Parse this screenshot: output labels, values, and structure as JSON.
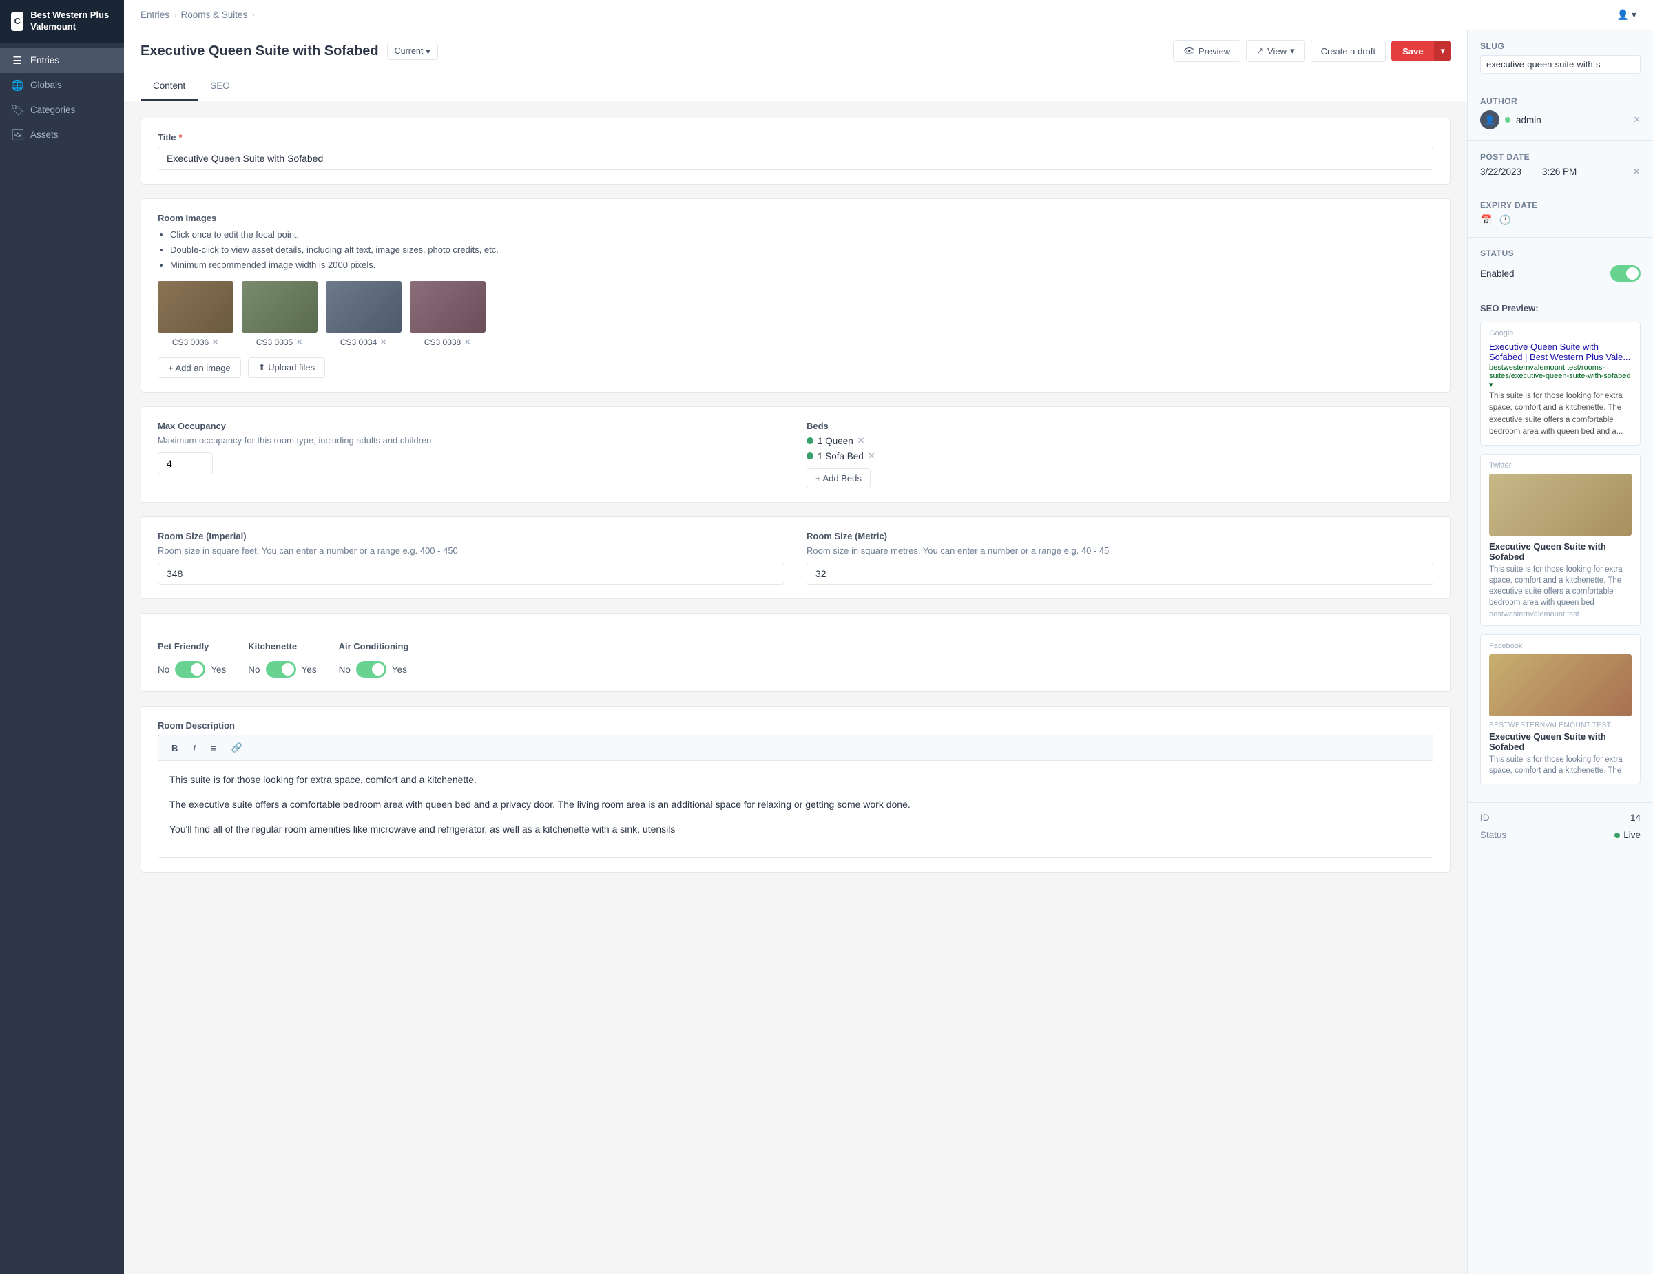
{
  "app": {
    "logo_text": "C",
    "brand_name": "Best Western Plus Valemount"
  },
  "sidebar": {
    "items": [
      {
        "id": "entries",
        "label": "Entries",
        "icon": "☰",
        "active": true
      },
      {
        "id": "globals",
        "label": "Globals",
        "icon": "🌐"
      },
      {
        "id": "categories",
        "label": "Categories",
        "icon": "🏷"
      },
      {
        "id": "assets",
        "label": "Assets",
        "icon": "🖼"
      }
    ]
  },
  "breadcrumb": {
    "items": [
      "Entries",
      "Rooms & Suites"
    ]
  },
  "entry_header": {
    "title": "Executive Queen Suite with Sofabed",
    "current_badge": "Current",
    "preview_label": "Preview",
    "view_label": "View",
    "draft_label": "Create a draft",
    "save_label": "Save"
  },
  "tabs": [
    {
      "id": "content",
      "label": "Content",
      "active": true
    },
    {
      "id": "seo",
      "label": "SEO",
      "active": false
    }
  ],
  "form": {
    "title_label": "Title",
    "title_value": "Executive Queen Suite with Sofabed",
    "room_images_label": "Room Images",
    "room_images_instructions": [
      "Click once to edit the focal point.",
      "Double-click to view asset details, including alt text, image sizes, photo credits, etc.",
      "Minimum recommended image width is 2000 pixels."
    ],
    "images": [
      {
        "label": "CS3 0036"
      },
      {
        "label": "CS3 0035"
      },
      {
        "label": "CS3 0034"
      },
      {
        "label": "CS3 0038"
      }
    ],
    "add_image_label": "+ Add an image",
    "upload_files_label": "⬆ Upload files",
    "max_occupancy_label": "Max Occupancy",
    "max_occupancy_desc": "Maximum occupancy for this room type, including adults and children.",
    "max_occupancy_value": "4",
    "beds_label": "Beds",
    "beds": [
      {
        "label": "1 Queen"
      },
      {
        "label": "1 Sofa Bed"
      }
    ],
    "add_beds_label": "+ Add Beds",
    "room_size_imperial_label": "Room Size (Imperial)",
    "room_size_imperial_desc": "Room size in square feet. You can enter a number or a range e.g. 400 - 450",
    "room_size_imperial_value": "348",
    "room_size_metric_label": "Room Size (Metric)",
    "room_size_metric_desc": "Room size in square metres. You can enter a number or a range e.g. 40 - 45",
    "room_size_metric_value": "32",
    "pet_friendly_label": "Pet Friendly",
    "pet_friendly_no": "No",
    "pet_friendly_yes": "Yes",
    "pet_friendly_enabled": true,
    "kitchenette_label": "Kitchenette",
    "kitchenette_no": "No",
    "kitchenette_yes": "Yes",
    "kitchenette_enabled": true,
    "air_conditioning_label": "Air Conditioning",
    "air_conditioning_no": "No",
    "air_conditioning_yes": "Yes",
    "air_conditioning_enabled": true,
    "room_description_label": "Room Description",
    "description_paragraphs": [
      "This suite is for those looking for extra space, comfort and a kitchenette.",
      "The executive suite offers a comfortable bedroom area with queen bed and a privacy door. The living room area is an additional space for relaxing or getting some work done.",
      "You'll find all of the regular room amenities like microwave and refrigerator, as well as a kitchenette with a sink, utensils"
    ]
  },
  "right_panel": {
    "slug_label": "Slug",
    "slug_value": "executive-queen-suite-with-s",
    "author_label": "Author",
    "author_name": "admin",
    "author_dot_color": "#68d391",
    "post_date_label": "Post Date",
    "post_date": "3/22/2023",
    "post_time": "3:26 PM",
    "expiry_date_label": "Expiry Date",
    "status_label": "STATUS",
    "status_text": "Enabled",
    "seo_preview_label": "SEO Preview:",
    "google_label": "Google",
    "google_title": "Executive Queen Suite with Sofabed | Best Western Plus Vale...",
    "google_url": "bestwesternvalemount.test/rooms-suites/executive-queen-suite-with-sofabed ▾",
    "google_desc": "This suite is for those looking for extra space, comfort and a kitchenette. The executive suite offers a comfortable bedroom area with queen bed and a...",
    "twitter_label": "Twitter",
    "twitter_card_title": "Executive Queen Suite with Sofabed",
    "twitter_card_desc": "This suite is for those looking for extra space, comfort and a kitchenette. The executive suite offers a comfortable bedroom area with queen bed",
    "twitter_card_url": "bestwesternvalemount.test",
    "facebook_label": "Facebook",
    "fb_site_name": "BESTWESTERNVALEMOUNT.TEST",
    "fb_card_title": "Executive Queen Suite with Sofabed",
    "fb_card_desc": "This suite is for those looking for extra space, comfort and a kitchenette. The",
    "id_label": "ID",
    "id_value": "14",
    "status_bottom_label": "Status",
    "status_bottom_value": "Live"
  }
}
